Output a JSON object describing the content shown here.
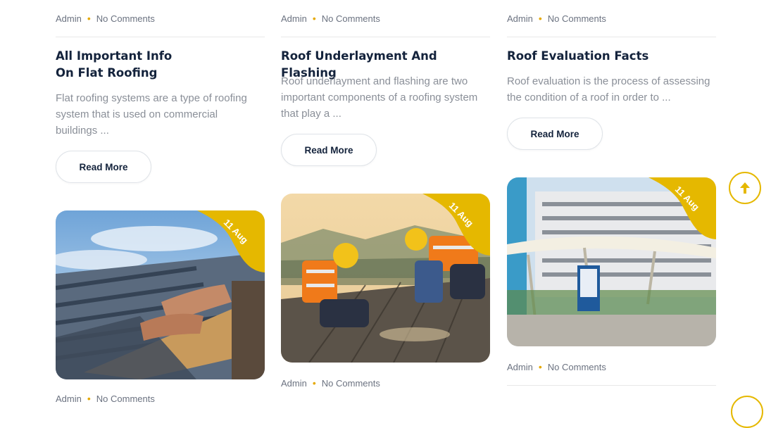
{
  "posts": [
    {
      "meta": {
        "author": "Admin",
        "comments": "No Comments"
      },
      "title_line1": "All Important Info",
      "title_line2": "On Flat Roofing",
      "excerpt_lines": [
        "Flat roofing systems are a type of roofing",
        "system that is used on commercial",
        "buildings ..."
      ],
      "read_more": "Read More"
    },
    {
      "meta": {
        "author": "Admin",
        "comments": "No Comments"
      },
      "title": "Roof Underlayment And Flashing",
      "excerpt_lines": [
        "Roof underlayment and flashing are two",
        "important components of a roofing system",
        "that play a ..."
      ],
      "read_more": "Read More"
    },
    {
      "meta": {
        "author": "Admin",
        "comments": "No Comments"
      },
      "title": "Roof Evaluation Facts",
      "excerpt_lines": [
        "Roof evaluation is the process of assessing",
        "the condition of a roof in order to ..."
      ],
      "read_more": "Read More"
    }
  ],
  "next_cards": [
    {
      "date": "11 Aug",
      "meta": {
        "author": "Admin",
        "comments": "No Comments"
      }
    },
    {
      "date": "11 Aug",
      "meta": {
        "author": "Admin",
        "comments": "No Comments"
      }
    },
    {
      "date": "11 Aug",
      "meta": {
        "author": "Admin",
        "comments": "No Comments"
      }
    }
  ],
  "colors": {
    "accent": "#e5b800",
    "heading": "#14233c",
    "muted": "#8a8f98"
  },
  "icons": {
    "scroll_top": "arrow-up-icon"
  }
}
